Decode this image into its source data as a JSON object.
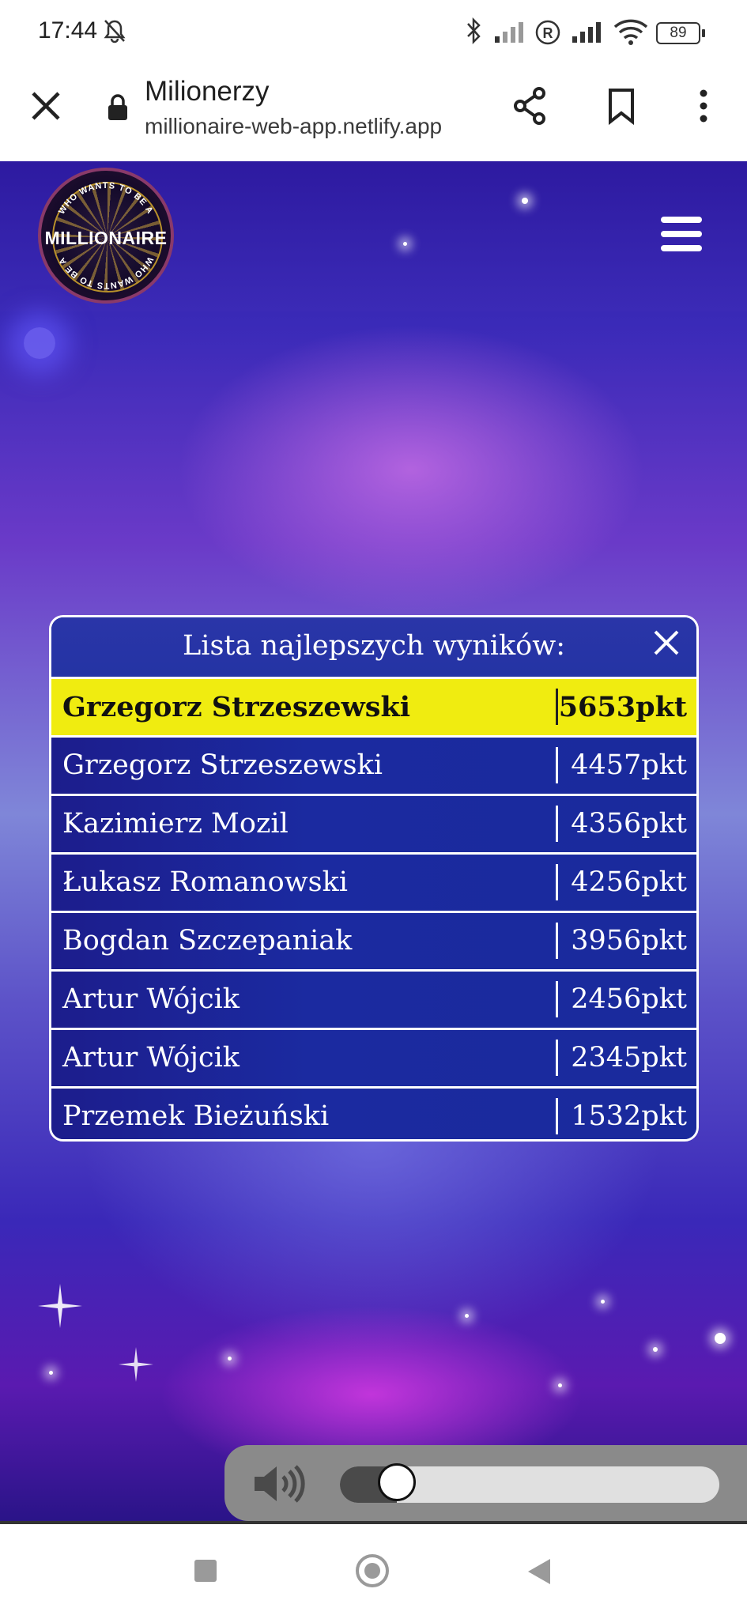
{
  "status_bar": {
    "time": "17:44",
    "icons": [
      "bell-off-icon",
      "bluetooth-icon",
      "signal-weak-icon",
      "roaming-icon",
      "signal-icon",
      "wifi-icon",
      "battery-icon"
    ],
    "battery": "89"
  },
  "browser": {
    "page_title": "Milionerzy",
    "url": "millionaire-web-app.netlify.app",
    "icons": [
      "close-icon",
      "lock-icon",
      "share-icon",
      "bookmark-icon",
      "more-vert-icon"
    ]
  },
  "game": {
    "logo": {
      "main_text": "MILLIONAIRE",
      "arc_top": "WHO WANTS TO BE A",
      "arc_bottom": "WHO WANTS TO BE A"
    },
    "menu_icon": "hamburger-menu-icon",
    "leaderboard": {
      "title": "Lista najlepszych wyników:",
      "close_icon": "close-icon",
      "entries": [
        {
          "name": "Grzegorz Strzeszewski",
          "score": "5653pkt",
          "highlighted": true
        },
        {
          "name": "Grzegorz Strzeszewski",
          "score": "4457pkt",
          "highlighted": false
        },
        {
          "name": "Kazimierz Mozil",
          "score": "4356pkt",
          "highlighted": false
        },
        {
          "name": "Łukasz Romanowski",
          "score": "4256pkt",
          "highlighted": false
        },
        {
          "name": "Bogdan Szczepaniak",
          "score": "3956pkt",
          "highlighted": false
        },
        {
          "name": "Artur Wójcik",
          "score": "2456pkt",
          "highlighted": false
        },
        {
          "name": "Artur Wójcik",
          "score": "2345pkt",
          "highlighted": false
        },
        {
          "name": "Przemek Bieżuński",
          "score": "1532pkt",
          "highlighted": false
        }
      ]
    },
    "audio": {
      "icon": "speaker-volume-icon",
      "volume_fraction": 0.15
    }
  },
  "nav_bar": {
    "icons": [
      "recents-square-icon",
      "home-circle-icon",
      "back-triangle-icon"
    ]
  },
  "colors": {
    "highlight": "#f0ec10",
    "panel_blue": "#1b1a8e",
    "border": "#ffffff"
  }
}
